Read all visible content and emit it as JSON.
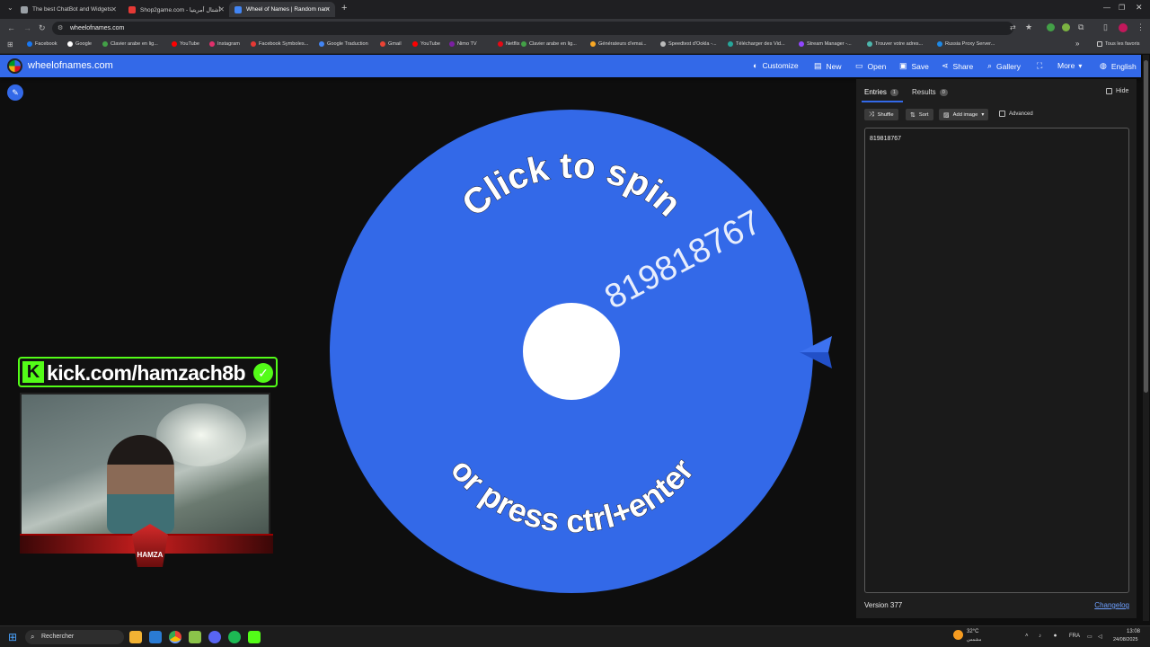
{
  "browser": {
    "tabs": [
      {
        "title": "The best ChatBot and Widgets",
        "color": "#9aa0a6",
        "active": false
      },
      {
        "title": "Shop2game.com - أشتال أمريتيا",
        "color": "#e53935",
        "active": false
      },
      {
        "title": "Wheel of Names | Random nam",
        "color": "#4285f4",
        "active": true
      }
    ],
    "new_tab": "+",
    "url": "wheelofnames.com",
    "bookmarks": [
      {
        "label": "Facebook",
        "color": "#1877f2"
      },
      {
        "label": "Google",
        "color": "#ffffff"
      },
      {
        "label": "Clavier arabe en lig...",
        "color": "#43a047"
      },
      {
        "label": "YouTube",
        "color": "#ff0000"
      },
      {
        "label": "Instagram",
        "color": "#e1306c"
      },
      {
        "label": "Facebook Symboles...",
        "color": "#e53935"
      },
      {
        "label": "Google Traduction",
        "color": "#4285f4"
      },
      {
        "label": "Gmail",
        "color": "#ea4335"
      },
      {
        "label": "YouTube",
        "color": "#ff0000"
      },
      {
        "label": "Nimo TV",
        "color": "#7b1fa2"
      },
      {
        "label": "Netflix",
        "color": "#e50914"
      },
      {
        "label": "Clavier arabe en lig...",
        "color": "#43a047"
      },
      {
        "label": "Générateurs d'emai...",
        "color": "#f9a825"
      },
      {
        "label": "Speedtest d'Ookla -...",
        "color": "#bbbbbb"
      },
      {
        "label": "Télécharger des Vid...",
        "color": "#26a69a"
      },
      {
        "label": "Stream Manager -...",
        "color": "#9146ff"
      },
      {
        "label": "Trouver votre adres...",
        "color": "#4db6ac"
      },
      {
        "label": "Russia Proxy Server...",
        "color": "#1e88e5"
      }
    ],
    "bookmarks_more": "»",
    "all_bookmarks": "Tous les favoris"
  },
  "site": {
    "name": "wheelofnames.com",
    "nav": [
      {
        "label": "Customize",
        "icon": "palette-icon",
        "glyph": "◐"
      },
      {
        "label": "New",
        "icon": "file-icon",
        "glyph": "▤"
      },
      {
        "label": "Open",
        "icon": "folder-icon",
        "glyph": "▭"
      },
      {
        "label": "Save",
        "icon": "save-icon",
        "glyph": "▣"
      },
      {
        "label": "Share",
        "icon": "share-icon",
        "glyph": "⋖"
      },
      {
        "label": "Gallery",
        "icon": "search-icon",
        "glyph": "⌕"
      },
      {
        "label": "",
        "icon": "fullscreen-icon",
        "glyph": "⛶"
      },
      {
        "label": "More",
        "icon": "chevron-down-icon",
        "glyph": "▾"
      },
      {
        "label": "English",
        "icon": "globe-icon",
        "glyph": "◍"
      }
    ]
  },
  "wheel": {
    "color": "#3369e8",
    "center_color": "#ffffff",
    "prompt_top": "Click to spin",
    "prompt_bottom": "or press ctrl+enter",
    "entry_label": "819818767"
  },
  "panel": {
    "tab_entries": "Entries",
    "entries_count": "1",
    "tab_results": "Results",
    "results_count": "0",
    "hide_label": "Hide",
    "shuffle_label": "Shuffle",
    "sort_label": "Sort",
    "add_image_label": "Add image",
    "advanced_label": "Advanced",
    "entries_text": "819818767",
    "version": "Version 377",
    "changelog": "Changelog"
  },
  "overlay": {
    "kick_handle": "kick.com/hamzach8b",
    "kick_k": "K",
    "emblem_text": "HAMZA"
  },
  "taskbar": {
    "search_placeholder": "Rechercher",
    "weather": "32°C",
    "weather_sub": "مشمس",
    "lang": "FRA",
    "time": "13:08",
    "date": "24/08/2025"
  }
}
